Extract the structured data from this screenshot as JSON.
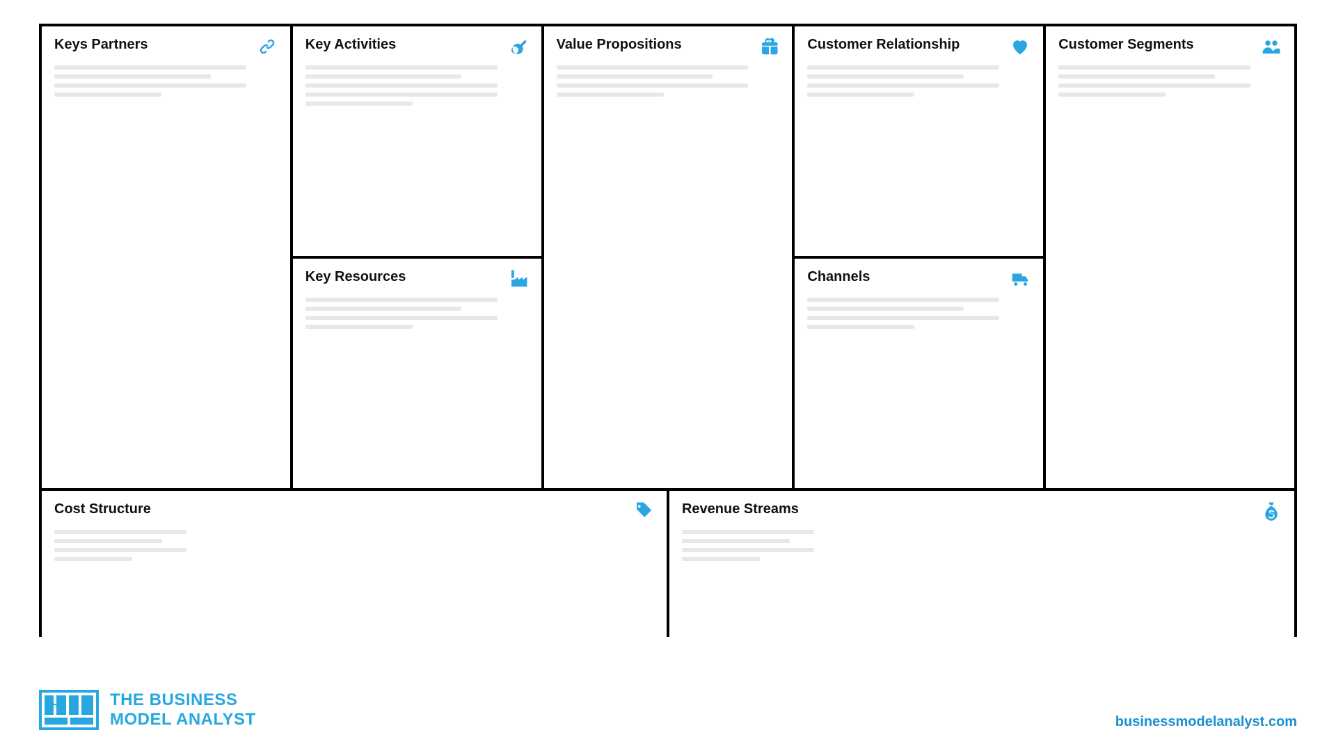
{
  "accent": "#2ca6e3",
  "canvas": {
    "key_partners": {
      "title": "Keys Partners",
      "icon": "link-icon"
    },
    "key_activities": {
      "title": "Key Activities",
      "icon": "key-icon"
    },
    "key_resources": {
      "title": "Key Resources",
      "icon": "factory-icon"
    },
    "value_propositions": {
      "title": "Value Propositions",
      "icon": "gift-icon"
    },
    "customer_relationship": {
      "title": "Customer Relationship",
      "icon": "heart-icon"
    },
    "channels": {
      "title": "Channels",
      "icon": "truck-icon"
    },
    "customer_segments": {
      "title": "Customer Segments",
      "icon": "people-icon"
    },
    "cost_structure": {
      "title": "Cost Structure",
      "icon": "tag-icon"
    },
    "revenue_streams": {
      "title": "Revenue Streams",
      "icon": "moneybag-icon"
    }
  },
  "footer": {
    "brand_line1": "THE BUSINESS",
    "brand_line2": "MODEL ANALYST",
    "site": "businessmodelanalyst.com"
  }
}
